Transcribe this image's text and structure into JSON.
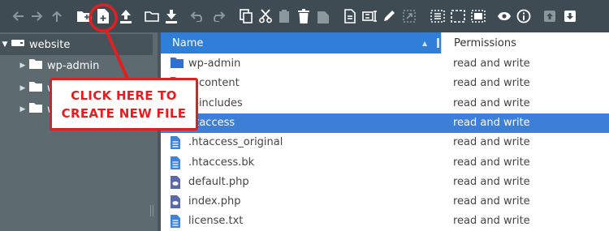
{
  "toolbar": {
    "icons": [
      "back-arrow-icon",
      "forward-arrow-icon",
      "up-arrow-icon",
      "new-folder-icon",
      "new-file-icon",
      "upload-icon",
      "open-folder-icon",
      "download-icon",
      "undo-icon",
      "redo-icon",
      "copy-icon",
      "cut-icon",
      "paste-icon",
      "delete-icon",
      "empty-icon",
      "duplicate-icon",
      "rename-icon",
      "edit-icon",
      "resize-icon",
      "select-all-icon",
      "select-none-icon",
      "invert-selection-icon",
      "preview-icon",
      "info-icon",
      "extract-icon",
      "archive-icon"
    ]
  },
  "tree": {
    "root": {
      "label": "website",
      "icon": "drive-icon"
    },
    "children": [
      {
        "label": "wp-admin",
        "icon": "folder-icon"
      },
      {
        "label": "w",
        "icon": "folder-icon"
      },
      {
        "label": "w",
        "icon": "folder-icon"
      }
    ]
  },
  "list": {
    "columns": {
      "name": "Name",
      "permissions": "Permissions"
    },
    "rows": [
      {
        "name": "wp-admin",
        "permissions": "read and write",
        "icon": "folder-icon"
      },
      {
        "name": "p-content",
        "permissions": "read and write",
        "icon": "folder-icon"
      },
      {
        "name": "p-includes",
        "permissions": "read and write",
        "icon": "folder-icon"
      },
      {
        "name": "htaccess",
        "permissions": "read and write",
        "icon": "file-icon"
      },
      {
        "name": ".htaccess_original",
        "permissions": "read and write",
        "icon": "file-icon"
      },
      {
        "name": ".htaccess.bk",
        "permissions": "read and write",
        "icon": "file-icon"
      },
      {
        "name": "default.php",
        "permissions": "read and write",
        "icon": "php-file-icon"
      },
      {
        "name": "index.php",
        "permissions": "read and write",
        "icon": "php-file-icon"
      },
      {
        "name": "license.txt",
        "permissions": "read and write",
        "icon": "file-icon"
      }
    ],
    "selected_index": 3
  },
  "annotation": {
    "line1": "CLICK HERE TO",
    "line2": "CREATE NEW FILE",
    "color": "#e02020"
  }
}
